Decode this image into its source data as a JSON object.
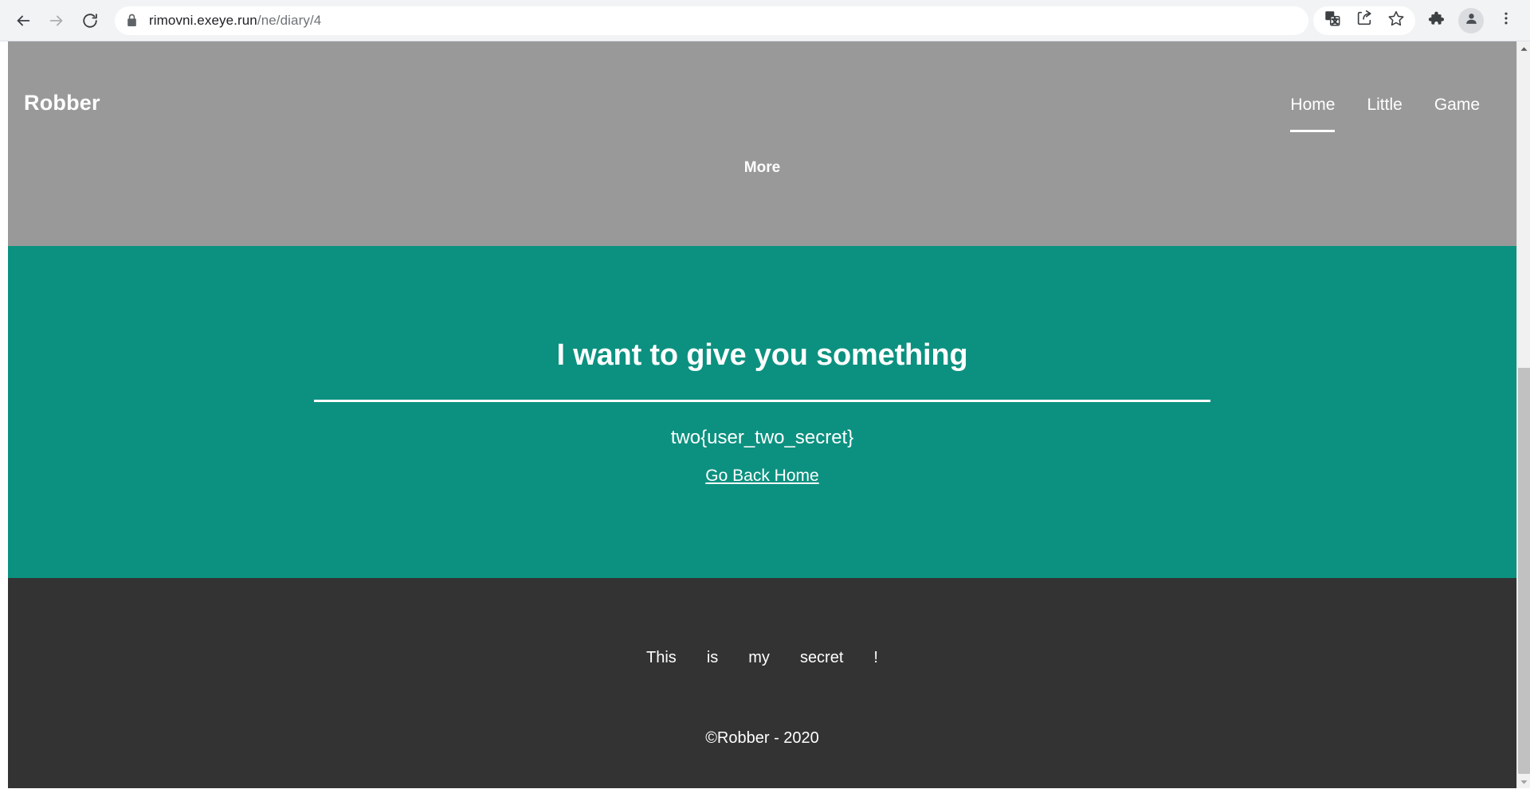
{
  "browser": {
    "back_icon": "back-arrow-icon",
    "forward_icon": "forward-arrow-icon",
    "reload_icon": "reload-icon",
    "lock_icon": "lock-icon",
    "url_domain": "rimovni.exeye.run",
    "url_path": "/ne/diary/4",
    "url_full": "rimovni.exeye.run/ne/diary/4",
    "actions": [
      {
        "name": "translate-icon",
        "title": "Translate this page"
      },
      {
        "name": "share-icon",
        "title": "Share this page"
      },
      {
        "name": "bookmark-star-icon",
        "title": "Bookmark this tab"
      }
    ],
    "extensions_icon": "puzzle-piece-icon",
    "profile_icon": "profile-avatar-icon",
    "menu_icon": "three-dot-menu-icon"
  },
  "site": {
    "brand": "Robber",
    "nav": [
      {
        "label": "Home",
        "active": true
      },
      {
        "label": "Little",
        "active": false
      },
      {
        "label": "Game",
        "active": false
      }
    ],
    "more_label": "More"
  },
  "hero": {
    "title": "I want to give you something",
    "flag": "two{user_two_secret}",
    "back_link": "Go Back Home"
  },
  "footer": {
    "words": [
      "This",
      "is",
      "my",
      "secret",
      "!"
    ],
    "copyright": "©Robber - 2020"
  },
  "scrollbar": {
    "up_arrow": "scroll-up-arrow-icon",
    "down_arrow": "scroll-down-arrow-icon"
  },
  "colors": {
    "header_gray": "#999999",
    "hero_teal": "#0c9180",
    "footer_dark": "#333333",
    "chrome_bg": "#f1f3f4",
    "text_white": "#ffffff"
  }
}
